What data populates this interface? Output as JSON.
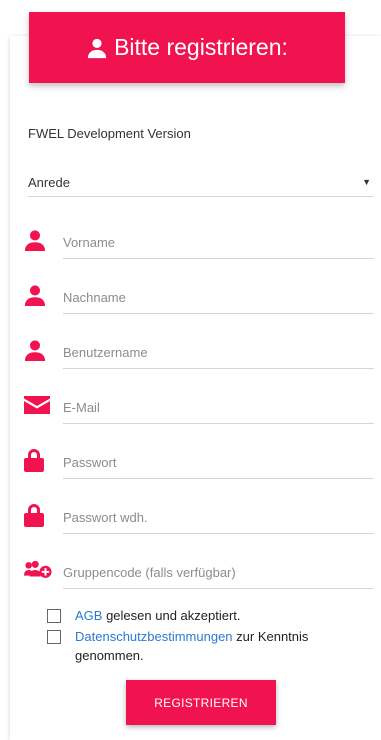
{
  "header": {
    "title": "Bitte registrieren:",
    "icon": "user-icon"
  },
  "env_label": "FWEL Development Version",
  "salutation": {
    "value": "Anrede",
    "arrow": "▼"
  },
  "fields": [
    {
      "placeholder": "Vorname",
      "icon": "user-icon"
    },
    {
      "placeholder": "Nachname",
      "icon": "user-icon"
    },
    {
      "placeholder": "Benutzername",
      "icon": "user-icon"
    },
    {
      "placeholder": "E-Mail",
      "icon": "envelope-icon"
    },
    {
      "placeholder": "Passwort",
      "icon": "lock-icon"
    },
    {
      "placeholder": "Passwort wdh.",
      "icon": "lock-icon"
    },
    {
      "placeholder": "Gruppencode (falls verfügbar)",
      "icon": "group-add-icon"
    }
  ],
  "agb": {
    "link": "AGB",
    "text": " gelesen und akzeptiert."
  },
  "privacy": {
    "link": "Datenschutzbestimmungen",
    "text": " zur Kenntnis genommen."
  },
  "submit_label": "REGISTRIEREN",
  "colors": {
    "accent": "#f0134f",
    "link": "#2a7ad2"
  }
}
